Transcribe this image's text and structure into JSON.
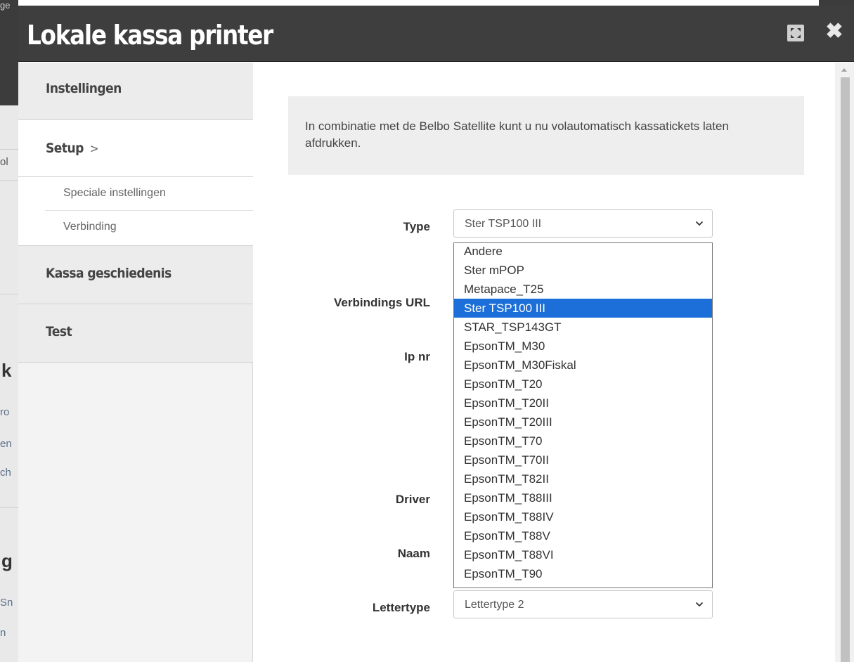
{
  "background": {
    "fragments": [
      "ge",
      "ol",
      "k",
      "ro",
      "en",
      "ch",
      "g",
      "Sn",
      "n"
    ]
  },
  "dialog": {
    "title": "Lokale kassa printer",
    "maximize_icon": "maximize-icon",
    "close_glyph": "✖"
  },
  "sidebar": {
    "items": [
      {
        "label": "Instellingen"
      },
      {
        "label": "Setup",
        "chevron": ">"
      },
      {
        "label": "Kassa geschiedenis"
      },
      {
        "label": "Test"
      }
    ],
    "subitems": [
      {
        "label": "Speciale instellingen"
      },
      {
        "label": "Verbinding"
      }
    ]
  },
  "main": {
    "info": "In combinatie met de Belbo Satellite kunt u nu volautomatisch kassatickets laten afdrukken.",
    "fields": {
      "type": {
        "label": "Type",
        "value": "Ster TSP100 III"
      },
      "url": {
        "label": "Verbindings URL"
      },
      "ip": {
        "label": "Ip nr"
      },
      "driver": {
        "label": "Driver"
      },
      "naam": {
        "label": "Naam"
      },
      "lettertype": {
        "label": "Lettertype",
        "value": "Lettertype 2"
      }
    },
    "type_options": [
      "Andere",
      "Ster mPOP",
      "Metapace_T25",
      "Ster TSP100 III",
      "STAR_TSP143GT",
      "EpsonTM_M30",
      "EpsonTM_M30Fiskal",
      "EpsonTM_T20",
      "EpsonTM_T20II",
      "EpsonTM_T20III",
      "EpsonTM_T70",
      "EpsonTM_T70II",
      "EpsonTM_T82II",
      "EpsonTM_T88III",
      "EpsonTM_T88IV",
      "EpsonTM_T88V",
      "EpsonTM_T88VI",
      "EpsonTM_T90"
    ],
    "selected_option": "Ster TSP100 III"
  },
  "colors": {
    "titlebar": "#3e3e3e",
    "selected_option": "#1c6fd8",
    "sidebar": "#ececec"
  }
}
